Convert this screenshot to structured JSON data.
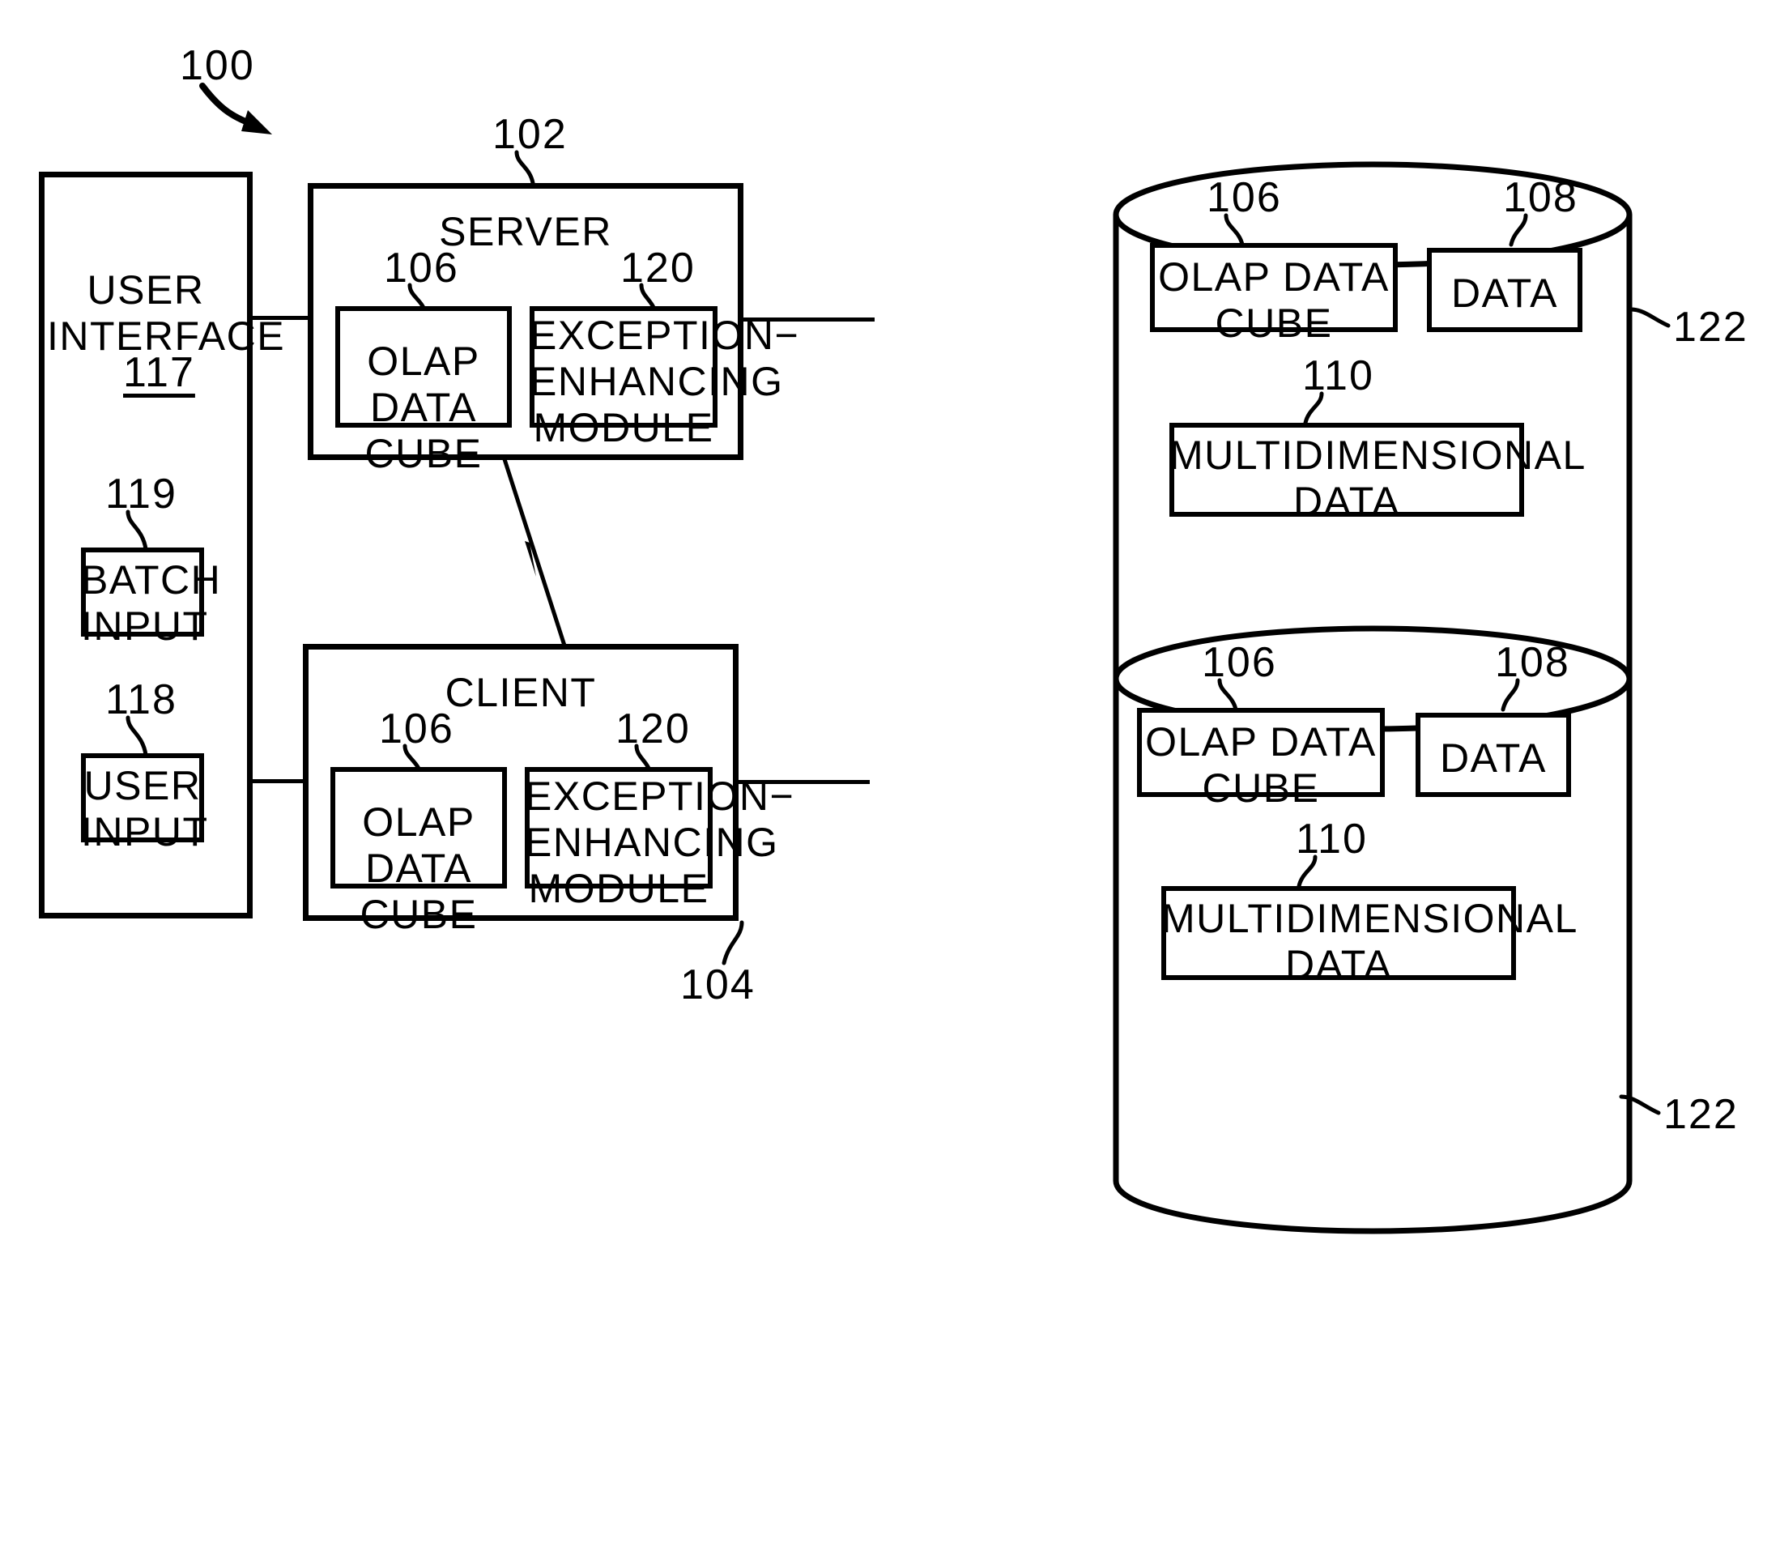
{
  "figure": {
    "system_numeral": "100",
    "arrow_icon": "curved-arrow-icon"
  },
  "user_interface": {
    "title": "USER\nINTERFACE",
    "numeral": "117",
    "children": [
      {
        "label": "BATCH\nINPUT",
        "numeral": "119"
      },
      {
        "label": "USER\nINPUT",
        "numeral": "118"
      }
    ]
  },
  "server": {
    "title": "SERVER",
    "numeral": "102",
    "children": [
      {
        "label": "OLAP DATA\nCUBE",
        "numeral": "106"
      },
      {
        "label": "EXCEPTION−\nENHANCING\nMODULE",
        "numeral": "120"
      }
    ]
  },
  "client": {
    "title": "CLIENT",
    "numeral": "104",
    "children": [
      {
        "label": "OLAP DATA\nCUBE",
        "numeral": "106"
      },
      {
        "label": "EXCEPTION−\nENHANCING\nMODULE",
        "numeral": "120"
      }
    ]
  },
  "database_top": {
    "numeral": "122",
    "children": [
      {
        "label": "OLAP DATA\nCUBE",
        "numeral": "106"
      },
      {
        "label": "DATA",
        "numeral": "108"
      },
      {
        "label": "MULTIDIMENSIONAL\nDATA",
        "numeral": "110"
      }
    ]
  },
  "database_bottom": {
    "numeral": "122",
    "children": [
      {
        "label": "OLAP DATA\nCUBE",
        "numeral": "106"
      },
      {
        "label": "DATA",
        "numeral": "108"
      },
      {
        "label": "MULTIDIMENSIONAL\nDATA",
        "numeral": "110"
      }
    ]
  },
  "colors": {
    "ink": "#000000",
    "paper": "#ffffff"
  }
}
